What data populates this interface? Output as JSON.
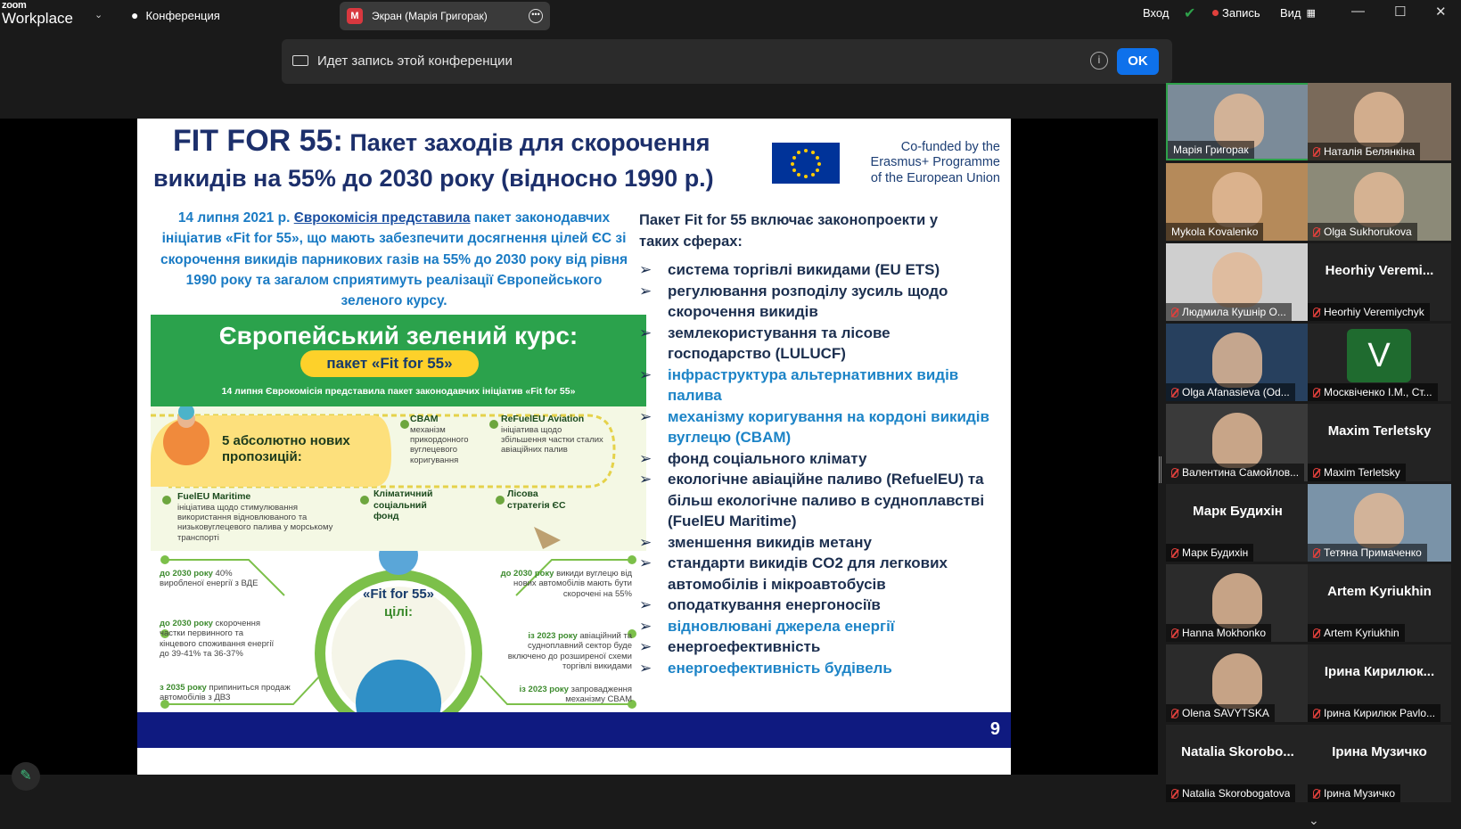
{
  "app": {
    "logo_top": "zoom",
    "logo_bottom": "Workplace",
    "meeting_label": "Конференция",
    "screen_tab": "Экран (Марія Григорак)",
    "screen_tab_initial": "M"
  },
  "topbar_right": {
    "enter": "Вход",
    "record": "Запись",
    "view": "Вид"
  },
  "banner": {
    "text": "Идет запись этой конференции",
    "ok": "OK"
  },
  "slide": {
    "title_a": "FIT FOR 55:",
    "title_b": "Пакет заходів для скорочення",
    "title_line2": "викидів на 55% до 2030 року (відносно 1990 р.)",
    "eu_text": [
      "Co-funded by the",
      "Erasmus+ Programme",
      "of the European Union"
    ],
    "intro_pre": "14 липня 2021 р. ",
    "intro_link": "Єврокомісія представила",
    "intro_post": " пакет законодавчих ініціатив «Fit for 55», що мають забезпечити досягнення цілей ЄС зі скорочення викидів парникових газів на 55% до 2030 року від рівня 1990 року та загалом сприятимуть реалізації Європейського зеленого курсу.",
    "ig_title": "Європейський зелений курс:",
    "ig_pill": "пакет «Fit for 55»",
    "ig_sub": "14 липня Єврокомісія представила пакет законодавчих ініціатив «Fit for 55»",
    "ig_five": "5 абсолютно нових пропозицій:",
    "cbam_t": "CBAM",
    "cbam_d": "механізм прикордонного вуглецевого коригування",
    "refuel_t": "ReFuelEU Aviation",
    "refuel_d": "ініціатива щодо збільшення частки сталих авіаційних палив",
    "fueleu_t": "FuelEU Maritime",
    "fueleu_d": "ініціатива щодо стимулювання використання відновлюваного та низьковуглецевого палива у морському транспорті",
    "climate_t": "Кліматичний соціальний фонд",
    "forest_t": "Лісова стратегія ЄС",
    "goals_title": "«Fit for 55»",
    "goals_sub": "цілі:",
    "g1_a": "до 2030 року",
    "g1_b": " 40% виробленої енергії з ВДЕ",
    "g2_a": "до 2030 року",
    "g2_b": " скорочення частки первинного та кінцевого споживання енергії до 39-41% та 36-37%",
    "g3_a": "з 2035 року",
    "g3_b": " припиниться продаж автомобілів з ДВЗ",
    "g4_a": "до 2030 року",
    "g4_b": " викиди вуглецю від нових автомобілів мають бути скорочені на 55%",
    "g5_a": "із 2023 року",
    "g5_b": " авіаційний та судноплавний сектор буде включено до розширеної схеми торгівлі викидами",
    "g6_a": "із 2023 року",
    "g6_b": " запровадження механізму CBAM",
    "right_heading": "Пакет Fit for 55  включає законопроекти у таких сферах:",
    "items": [
      {
        "t": "система торгівлі викидами (EU ETS)",
        "c": "d"
      },
      {
        "t": "регулювання розподілу зусиль щодо скорочення викидів",
        "c": "d"
      },
      {
        "t": "землекористування та лісове господарство (LULUCF)",
        "c": "d"
      },
      {
        "t": "інфраструктура альтернативних видів палива",
        "c": "b"
      },
      {
        "t": "механізму коригування на кордоні викидів вуглецю (CBAM)",
        "c": "b"
      },
      {
        "t": "фонд соціального клімату",
        "c": "d"
      },
      {
        "t": "екологічне авіаційне паливо (RefuelEU) та більш екологічне паливо в судноплавстві (FuelEU Maritime)",
        "c": "d"
      },
      {
        "t": "зменшення викидів метану",
        "c": "d"
      },
      {
        "t": "стандарти викидів CO2 для легкових автомобілів і мікроавтобусів",
        "c": "d"
      },
      {
        "t": "оподаткування енергоносіїв",
        "c": "d"
      },
      {
        "t": "відновлювані джерела енергії",
        "c": "b"
      },
      {
        "t": "енергоефективність",
        "c": "d"
      },
      {
        "t": "енергоефективність будівель",
        "c": "b"
      }
    ],
    "page_number": "9"
  },
  "participants": [
    {
      "name": "Марія Григорак",
      "video": true,
      "active": true,
      "muted": false,
      "bg": "#7b8b99"
    },
    {
      "name": "Наталія Белянкіна",
      "video": true,
      "muted": true,
      "bg": "#7a6a5a"
    },
    {
      "name": "Mykola Kovalenko",
      "video": true,
      "muted": false,
      "bg": "#b58a5a"
    },
    {
      "name": "Olga Sukhorukova",
      "video": true,
      "muted": true,
      "bg": "#8c8a78"
    },
    {
      "name": "Людмила Кушнір О...",
      "video": true,
      "muted": true,
      "bg": "#cfcfcf"
    },
    {
      "name": "Heorhiy Veremiychyk",
      "big": "Heorhiy  Veremi...",
      "video": false,
      "muted": true
    },
    {
      "name": "Olga Afanasieva (Od...",
      "video": true,
      "muted": true,
      "bg": "#27405e"
    },
    {
      "name": "Москвіченко І.М., Ст...",
      "video": false,
      "muted": true,
      "avatar": "V"
    },
    {
      "name": "Валентина Самойлов...",
      "video": true,
      "muted": true,
      "bg": "#3a3a3a"
    },
    {
      "name": "Maxim Terletsky",
      "big": "Maxim Terletsky",
      "video": false,
      "muted": true
    },
    {
      "name": "Марк Будихін",
      "big": "Марк Будихін",
      "video": false,
      "muted": true
    },
    {
      "name": "Тетяна Примаченко",
      "video": true,
      "muted": true,
      "bg": "#7a93a8"
    },
    {
      "name": "Hanna Mokhonko",
      "video": true,
      "muted": true,
      "bg": "#2b2b2b"
    },
    {
      "name": "Artem Kyriukhin",
      "big": "Artem Kyriukhin",
      "video": false,
      "muted": true
    },
    {
      "name": "Olena SAVYTSKA",
      "video": true,
      "muted": true,
      "bg": "#2b2b2b"
    },
    {
      "name": "Ірина Кирилюк Pavlo...",
      "big": "Ірина  Кирилюк...",
      "video": false,
      "muted": true
    },
    {
      "name": "Natalia Skorobogatova",
      "big": "Natalia  Skorobo...",
      "video": false,
      "muted": true
    },
    {
      "name": "Ірина Музичко",
      "big": "Ірина Музичко",
      "video": false,
      "muted": true
    }
  ]
}
